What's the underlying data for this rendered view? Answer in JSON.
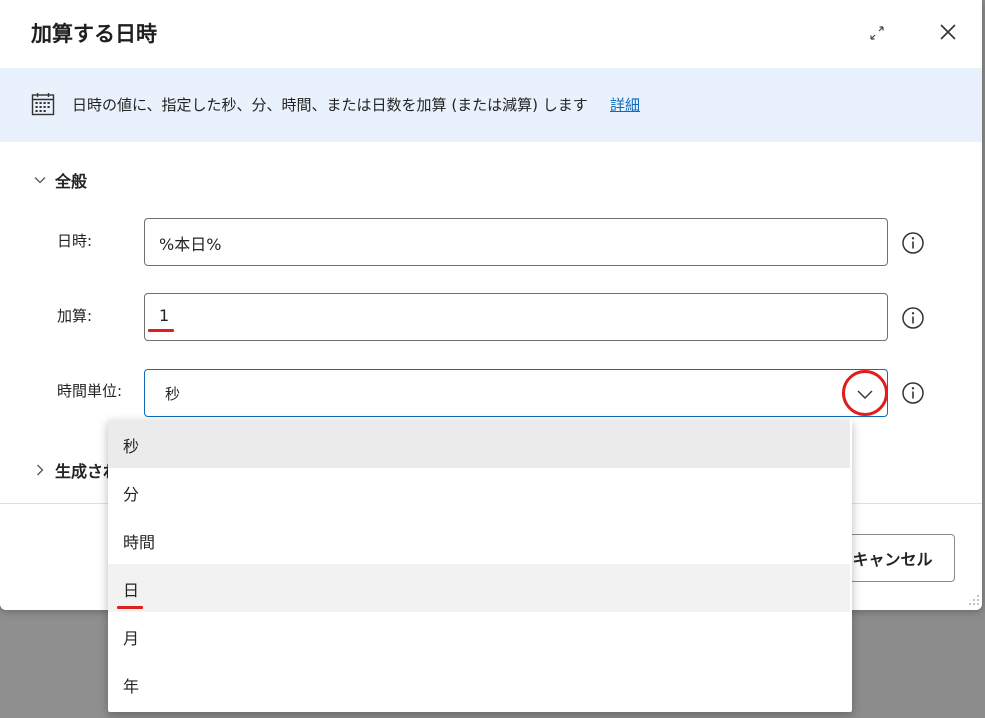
{
  "dialog": {
    "title": "加算する日時",
    "description": "日時の値に、指定した秒、分、時間、または日数を加算 (または減算) します",
    "details_link": "詳細"
  },
  "sections": {
    "general_label": "全般",
    "generated_label": "生成され"
  },
  "fields": {
    "datetime": {
      "label": "日時:",
      "value": "%本日%"
    },
    "add": {
      "label": "加算:",
      "value": "1"
    },
    "time_unit": {
      "label": "時間単位:",
      "value": "秒"
    }
  },
  "dropdown": {
    "options": [
      "秒",
      "分",
      "時間",
      "日",
      "月",
      "年"
    ],
    "selected": "秒",
    "highlighted": "日"
  },
  "footer": {
    "cancel_label": "キャンセル"
  },
  "colors": {
    "accent": "#0f6cbd",
    "info_bar": "#e8f1fc",
    "annotation_red": "#e01e1e"
  },
  "icons": {
    "expand": "expand-icon",
    "close": "close-icon",
    "calendar": "calendar-icon",
    "info": "info-icon",
    "chevron_down": "chevron-down-icon",
    "chevron_right": "chevron-right-icon"
  }
}
